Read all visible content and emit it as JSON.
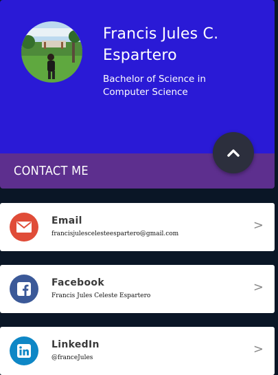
{
  "profile": {
    "name": "Francis Jules C. Espartero",
    "degree": "Bachelor of Science in Computer Science",
    "avatar_icon": "profile-photo"
  },
  "contact": {
    "title": "CONTACT ME",
    "scroll_top_icon": "chevron-up-icon"
  },
  "cards": [
    {
      "label": "Email",
      "value": "francisjulescelesteespartero@gmail.com",
      "icon": "envelope-icon",
      "color": "#e04c38",
      "chevron": ">"
    },
    {
      "label": "Facebook",
      "value": "Francis Jules Celeste Espartero",
      "icon": "facebook-icon",
      "color": "#3b5998",
      "chevron": ">"
    },
    {
      "label": "LinkedIn",
      "value": "@franceJules",
      "icon": "linkedin-icon",
      "color": "#0e87c6",
      "chevron": ">"
    }
  ],
  "colors": {
    "header_bg": "#2a1ad6",
    "contact_bar_bg": "#5d2f8e",
    "page_bg": "#0a1626",
    "fab_bg": "#2c2f3d"
  }
}
